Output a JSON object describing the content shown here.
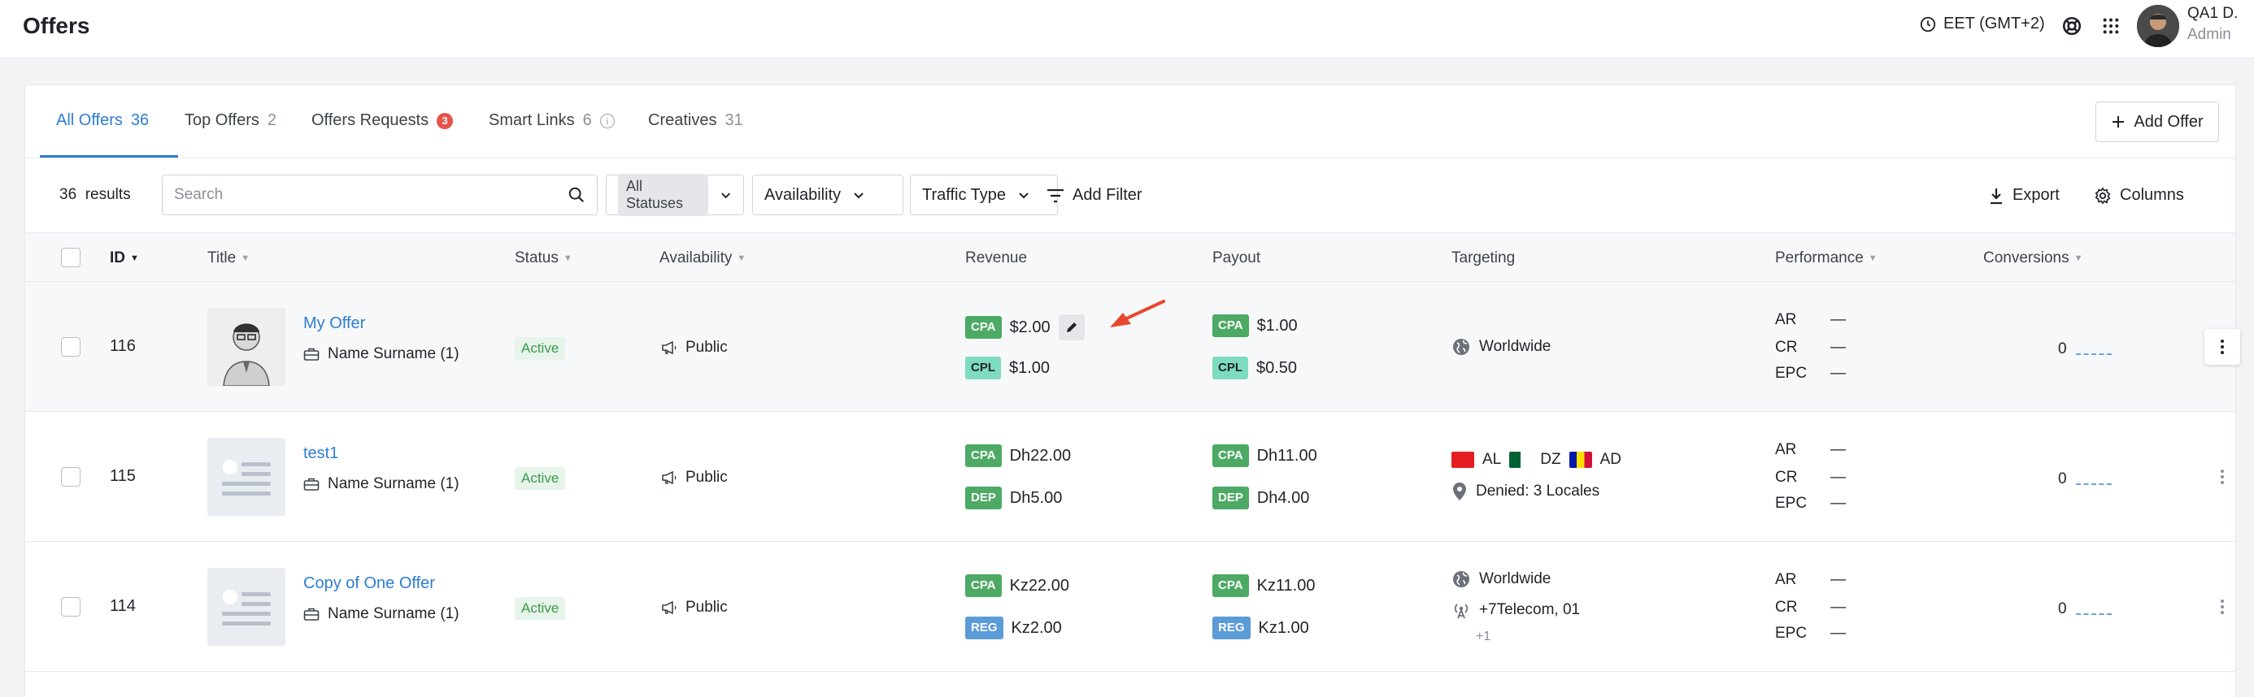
{
  "header": {
    "title": "Offers",
    "timezone": "EET (GMT+2)",
    "user_name": "QA1 D.",
    "user_role": "Admin"
  },
  "tabs": [
    {
      "label": "All Offers",
      "count": "36"
    },
    {
      "label": "Top Offers",
      "count": "2"
    },
    {
      "label": "Offers Requests",
      "count": "3"
    },
    {
      "label": "Smart Links",
      "count": "6"
    },
    {
      "label": "Creatives",
      "count": "31"
    }
  ],
  "add_offer_label": "Add Offer",
  "filters": {
    "results_count": "36",
    "results_label": "results",
    "search_placeholder": "Search",
    "status_select": "All Statuses",
    "availability_select": "Availability",
    "traffic_select": "Traffic Type",
    "add_filter_label": "Add Filter",
    "export_label": "Export",
    "columns_label": "Columns"
  },
  "columns": {
    "id": "ID",
    "title": "Title",
    "status": "Status",
    "availability": "Availability",
    "revenue": "Revenue",
    "payout": "Payout",
    "targeting": "Targeting",
    "performance": "Performance",
    "conversions": "Conversions"
  },
  "rows": [
    {
      "id": "116",
      "title": "My Offer",
      "owner": "Name Surname (1)",
      "status": "Active",
      "availability": "Public",
      "revenue": [
        {
          "type": "CPA",
          "value": "$2.00"
        },
        {
          "type": "CPL",
          "value": "$1.00"
        }
      ],
      "payout": [
        {
          "type": "CPA",
          "value": "$1.00"
        },
        {
          "type": "CPL",
          "value": "$0.50"
        }
      ],
      "targeting_line1": "Worldwide",
      "perf": {
        "ar": "AR",
        "cr": "CR",
        "epc": "EPC",
        "dash": "—"
      },
      "conversions": "0"
    },
    {
      "id": "115",
      "title": "test1",
      "owner": "Name Surname (1)",
      "status": "Active",
      "availability": "Public",
      "revenue": [
        {
          "type": "CPA",
          "value": "Dh22.00"
        },
        {
          "type": "DEP",
          "value": "Dh5.00"
        }
      ],
      "payout": [
        {
          "type": "CPA",
          "value": "Dh11.00"
        },
        {
          "type": "DEP",
          "value": "Dh4.00"
        }
      ],
      "countries": [
        "AL",
        "DZ",
        "AD"
      ],
      "targeting_line2": "Denied: 3 Locales",
      "perf": {
        "ar": "AR",
        "cr": "CR",
        "epc": "EPC",
        "dash": "—"
      },
      "conversions": "0"
    },
    {
      "id": "114",
      "title": "Copy of One Offer",
      "owner": "Name Surname (1)",
      "status": "Active",
      "availability": "Public",
      "revenue": [
        {
          "type": "CPA",
          "value": "Kz22.00"
        },
        {
          "type": "REG",
          "value": "Kz2.00"
        }
      ],
      "payout": [
        {
          "type": "CPA",
          "value": "Kz11.00"
        },
        {
          "type": "REG",
          "value": "Kz1.00"
        }
      ],
      "targeting_line1": "Worldwide",
      "targeting_line2": "+7Telecom,  01",
      "targeting_more": "+1",
      "perf": {
        "ar": "AR",
        "cr": "CR",
        "epc": "EPC",
        "dash": "—"
      },
      "conversions": "0"
    }
  ],
  "colors": {
    "accent": "#2d7dd2",
    "active_bg": "#e6f4ea",
    "active_text": "#3b9a4f",
    "tag_cpa": "#4caa64",
    "tag_cpl": "#7ddbc0",
    "tag_reg": "#5b9bd8",
    "badge_red": "#e8534a",
    "arrow": "#e8472e"
  }
}
